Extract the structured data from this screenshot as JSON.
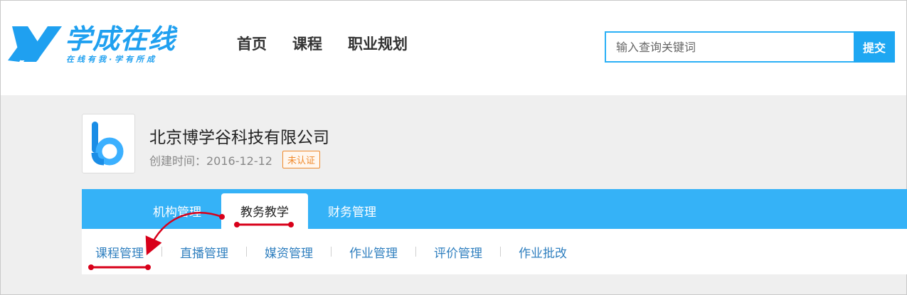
{
  "header": {
    "logo_title": "学成在线",
    "logo_slogan": "在线有我·学有所成",
    "nav": [
      "首页",
      "课程",
      "职业规划"
    ],
    "search": {
      "placeholder": "输入查询关键词",
      "button": "提交"
    }
  },
  "org": {
    "name": "北京博学谷科技有限公司",
    "created": "创建时间：2016-12-12",
    "badge": "未认证"
  },
  "tabs": [
    {
      "label": "机构管理",
      "active": false
    },
    {
      "label": "教务教学",
      "active": true
    },
    {
      "label": "财务管理",
      "active": false
    }
  ],
  "subnav": [
    "课程管理",
    "直播管理",
    "媒资管理",
    "作业管理",
    "评价管理",
    "作业批改"
  ],
  "colors": {
    "brand": "#1fa0f0",
    "tabbar": "#35b2f7",
    "link": "#2f7fbf",
    "annotation": "#d8001a",
    "badge": "#f08a2c"
  }
}
